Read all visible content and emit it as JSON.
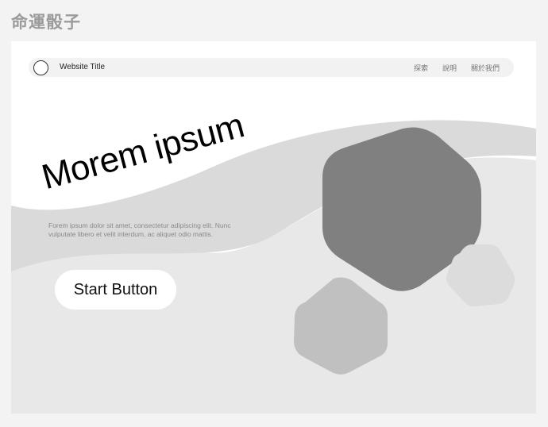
{
  "app_title": "命運骰子",
  "navbar": {
    "site_title": "Website Title",
    "links": [
      "探索",
      "說明",
      "關於我們"
    ]
  },
  "hero": {
    "headline": "Morem ipsum",
    "body": "Forem ipsum dolor sit amet, consectetur adipiscing elit. Nunc vulputate libero et velit interdum, ac aliquet odio mattis.",
    "start_button": "Start Button"
  },
  "colors": {
    "page_bg": "#f3f3f3",
    "wave_light": "#e8e8e8",
    "wave_dark": "#dadada",
    "hex_large": "#808080",
    "hex_medium": "#c0c0c0",
    "hex_small": "#dcdcdc"
  }
}
